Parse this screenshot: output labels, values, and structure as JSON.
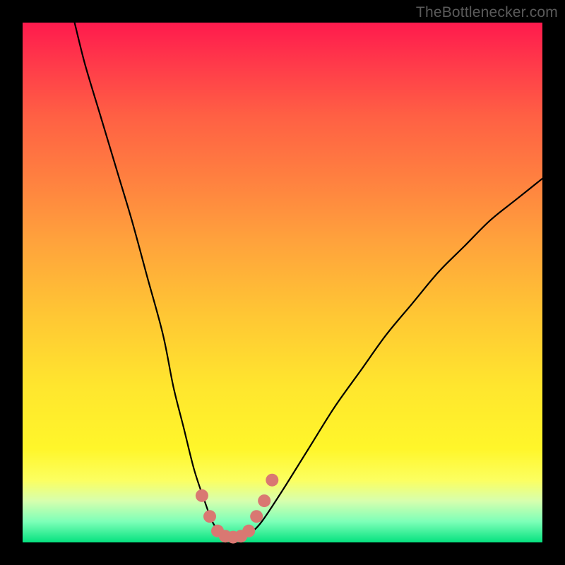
{
  "watermark": {
    "text": "TheBottlenecker.com"
  },
  "chart_data": {
    "type": "line",
    "title": "",
    "xlabel": "",
    "ylabel": "",
    "xlim": [
      0,
      100
    ],
    "ylim": [
      0,
      100
    ],
    "series": [
      {
        "name": "bottleneck-curve",
        "x": [
          10,
          12,
          15,
          18,
          21,
          24,
          27,
          29,
          31,
          33,
          35,
          36.5,
          38,
          40,
          42,
          44,
          46,
          50,
          55,
          60,
          65,
          70,
          75,
          80,
          85,
          90,
          95,
          100
        ],
        "y": [
          100,
          92,
          82,
          72,
          62,
          51,
          40,
          30,
          22,
          14,
          8,
          4,
          2,
          1,
          1,
          2,
          4,
          10,
          18,
          26,
          33,
          40,
          46,
          52,
          57,
          62,
          66,
          70
        ]
      }
    ],
    "markers": {
      "name": "highlighted-range",
      "x": [
        34.5,
        36,
        37.5,
        39,
        40.5,
        42,
        43.5,
        45,
        46.5,
        48
      ],
      "y": [
        9,
        5,
        2.2,
        1.2,
        1,
        1.2,
        2.2,
        5,
        8,
        12
      ]
    },
    "background_gradient": {
      "top": "#ff1a4d",
      "mid": "#ffe62e",
      "bottom": "#06e27f"
    }
  }
}
